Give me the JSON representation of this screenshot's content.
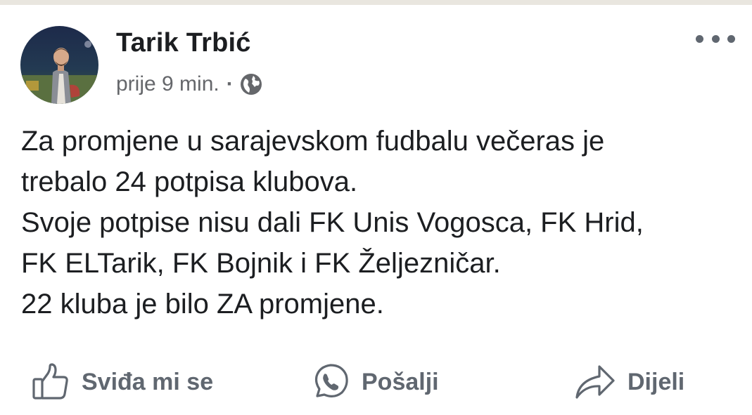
{
  "post": {
    "author": "Tarik Trbić",
    "time": "prije 9 min.",
    "separator": "·",
    "privacy_icon": "globe-icon",
    "menu_icon": "more-options-icon",
    "text_lines": [
      "Za promjene u sarajevskom fudbalu večeras je",
      "trebalo 24 potpisa klubova.",
      "Svoje potpise nisu dali FK Unis Vogosca, FK Hrid,",
      "FK ELTarik, FK Bojnik i FK Željezničar.",
      "22 kluba je bilo ZA promjene."
    ]
  },
  "actions": {
    "like": {
      "label": "Sviđa mi se",
      "icon": "thumbs-up-icon"
    },
    "send": {
      "label": "Pošalji",
      "icon": "whatsapp-icon"
    },
    "share": {
      "label": "Dijeli",
      "icon": "share-arrow-icon"
    }
  },
  "colors": {
    "text": "#1c1e21",
    "secondary": "#65676b",
    "action": "#606770",
    "top_strip": "#e9e6df"
  }
}
